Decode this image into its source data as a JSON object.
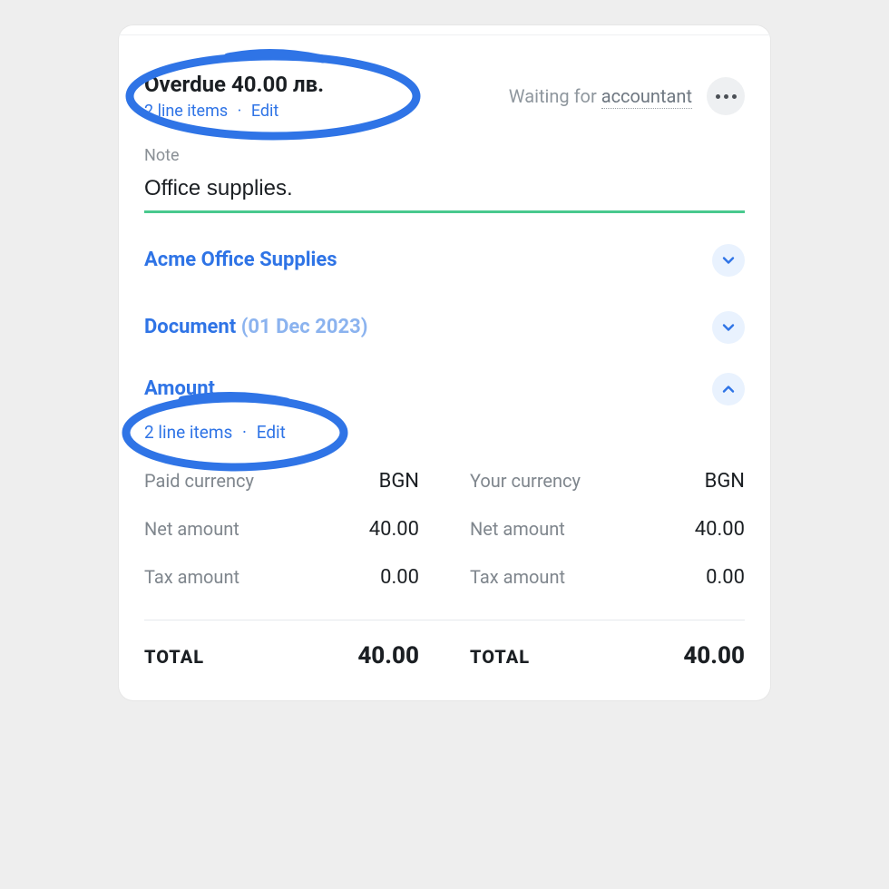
{
  "header": {
    "title": "Overdue 40.00 лв.",
    "line_items_label": "2 line items",
    "edit_label": "Edit",
    "waiting_prefix": "Waiting for ",
    "waiting_role": "accountant"
  },
  "note": {
    "label": "Note",
    "value": "Office supplies."
  },
  "sections": {
    "supplier": {
      "title": "Acme Office Supplies"
    },
    "document": {
      "title": "Document",
      "paren": "(01 Dec 2023)"
    },
    "amount": {
      "title": "Amount",
      "line_items_label": "2 line items",
      "edit_label": "Edit"
    }
  },
  "amount": {
    "left": {
      "currency_label": "Paid currency",
      "currency_value": "BGN",
      "net_label": "Net amount",
      "net_value": "40.00",
      "tax_label": "Tax amount",
      "tax_value": "0.00",
      "total_label": "TOTAL",
      "total_value": "40.00"
    },
    "right": {
      "currency_label": "Your currency",
      "currency_value": "BGN",
      "net_label": "Net amount",
      "net_value": "40.00",
      "tax_label": "Tax amount",
      "tax_value": "0.00",
      "total_label": "TOTAL",
      "total_value": "40.00"
    }
  }
}
